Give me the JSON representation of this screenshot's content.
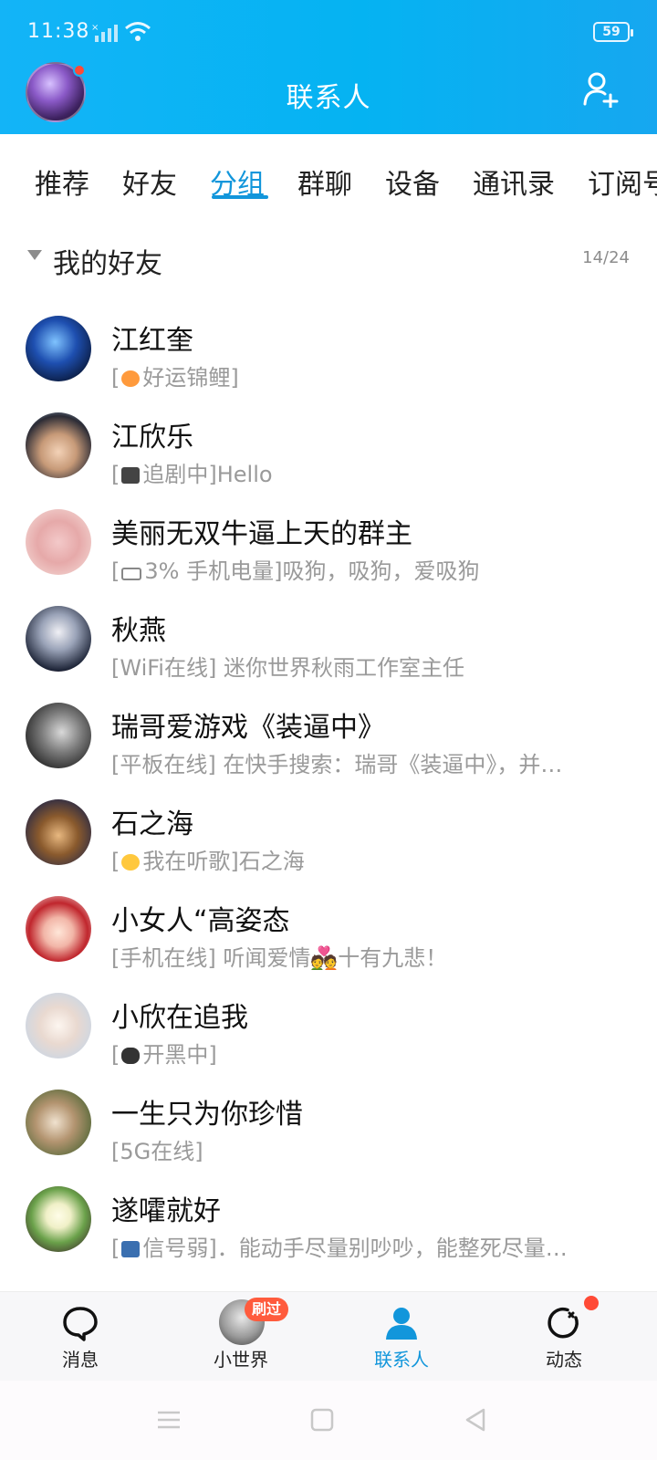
{
  "status_bar": {
    "time": "11:38",
    "battery": "59"
  },
  "header": {
    "title": "联系人"
  },
  "tabs": [
    {
      "label": "推荐"
    },
    {
      "label": "好友"
    },
    {
      "label": "分组",
      "active": true
    },
    {
      "label": "群聊"
    },
    {
      "label": "设备"
    },
    {
      "label": "通讯录"
    },
    {
      "label": "订阅号"
    }
  ],
  "group": {
    "title": "我的好友",
    "count": "14/24"
  },
  "contacts": [
    {
      "name": "江红奎",
      "status_prefix": "[",
      "icon": "koi-fish-icon",
      "status_text": "好运锦鲤]"
    },
    {
      "name": "江欣乐",
      "status_prefix": "[",
      "icon": "tv-icon",
      "status_text": "追剧中]Hello"
    },
    {
      "name": "美丽无双牛逼上天的群主",
      "status_prefix": "[",
      "icon": "battery-icon",
      "status_text": "3% 手机电量]吸狗，吸狗，爱吸狗"
    },
    {
      "name": "秋燕",
      "status_prefix": "",
      "icon": "",
      "status_text": "[WiFi在线] 迷你世界秋雨工作室主任"
    },
    {
      "name": "瑞哥爱游戏《装逼中》",
      "status_prefix": "",
      "icon": "",
      "status_text": "[平板在线] 在快手搜索：瑞哥《装逼中》，并…"
    },
    {
      "name": "石之海",
      "status_prefix": "[",
      "icon": "music-emoji-icon",
      "status_text": "我在听歌]石之海"
    },
    {
      "name": "小女人“高姿态",
      "status_prefix": "",
      "icon": "",
      "status_text": "[手机在线] 听闻爱情💑十有九悲！"
    },
    {
      "name": "小欣在追我",
      "status_prefix": "[",
      "icon": "gamepad-icon",
      "status_text": "开黑中]"
    },
    {
      "name": "一生只为你珍惜",
      "status_prefix": "",
      "icon": "",
      "status_text": "[5G在线]"
    },
    {
      "name": "遂嚯就好",
      "status_prefix": "[",
      "icon": "weak-signal-icon",
      "status_text": "信号弱]．能动手尽量别吵吵，能整死尽量…"
    }
  ],
  "bottom_nav": [
    {
      "label": "消息",
      "icon": "chat-bubble-icon"
    },
    {
      "label": "小世界",
      "icon": "mini-world-avatar",
      "badge": "刷过"
    },
    {
      "label": "联系人",
      "icon": "contacts-person-icon",
      "active": true
    },
    {
      "label": "动态",
      "icon": "refresh-star-icon"
    }
  ],
  "colors": {
    "header_blue": "#09b2f3",
    "accent": "#1296db",
    "badge_red": "#ff5b3d"
  }
}
